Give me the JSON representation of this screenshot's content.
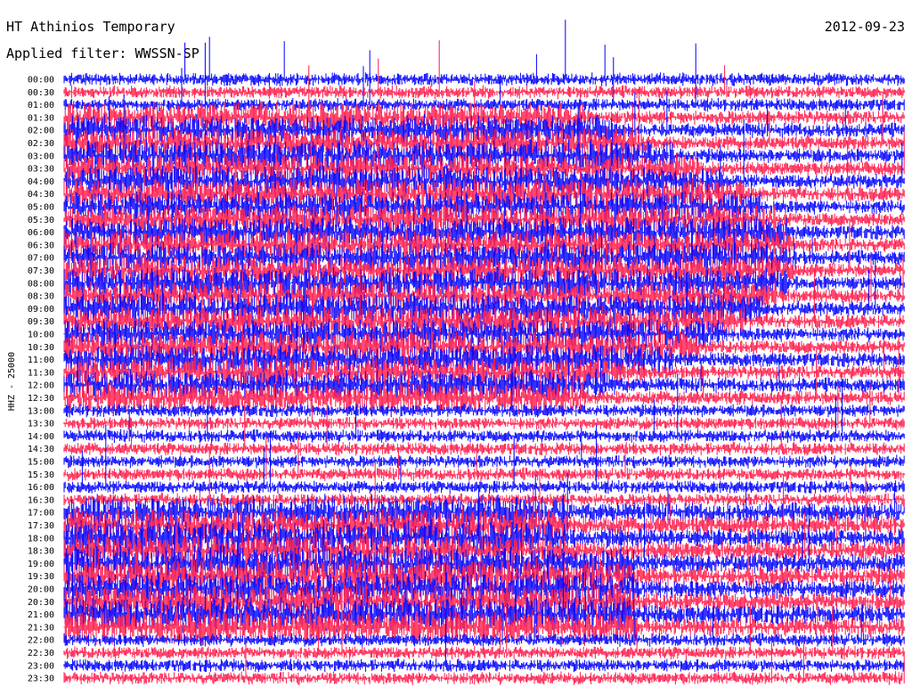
{
  "header": {
    "station": "HT Athinios Temporary",
    "date": "2012-09-23",
    "filter": "Applied filter: WWSSN-SP"
  },
  "chart_data": {
    "type": "helicorder",
    "title": "HT Athinios Temporary",
    "date": "2012-09-23",
    "filter": "WWSSN-SP",
    "ylabel": "HHZ - 25000",
    "interval_minutes": 30,
    "row_labels": [
      "00:00",
      "00:30",
      "01:00",
      "01:30",
      "02:00",
      "02:30",
      "03:00",
      "03:30",
      "04:00",
      "04:30",
      "05:00",
      "05:30",
      "06:00",
      "06:30",
      "07:00",
      "07:30",
      "08:00",
      "08:30",
      "09:00",
      "09:30",
      "10:00",
      "10:30",
      "11:00",
      "11:30",
      "12:00",
      "12:30",
      "13:00",
      "13:30",
      "14:00",
      "14:30",
      "15:00",
      "15:30",
      "16:00",
      "16:30",
      "17:00",
      "17:30",
      "18:00",
      "18:30",
      "19:00",
      "19:30",
      "20:00",
      "20:30",
      "21:00",
      "21:30",
      "22:00",
      "22:30",
      "23:00",
      "23:30"
    ],
    "trace_colors": [
      "#0000ff",
      "#ff1a4a"
    ],
    "colors": {
      "blue": "#0000ff",
      "red": "#ff1a4a",
      "background": "#ffffff",
      "text": "#000000"
    }
  }
}
